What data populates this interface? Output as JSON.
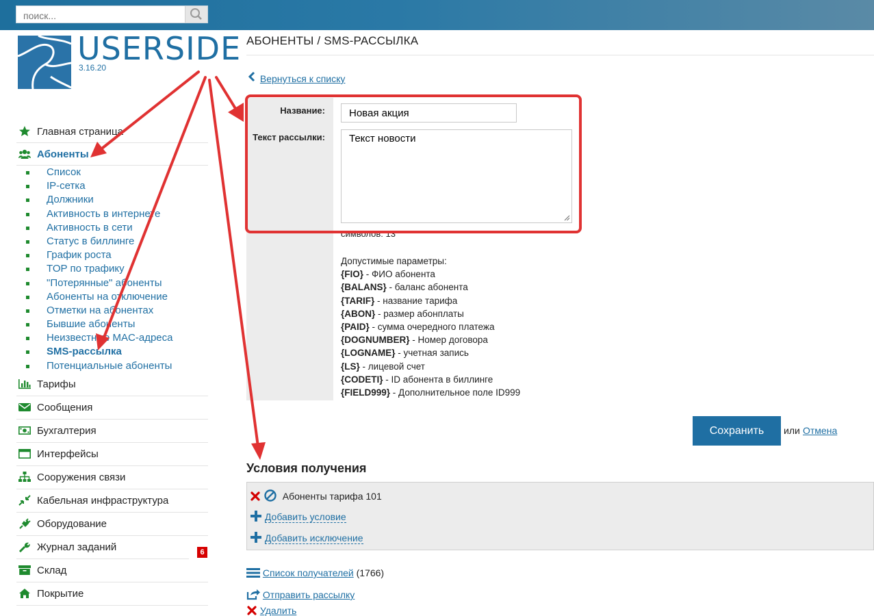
{
  "search": {
    "placeholder": "поиск..."
  },
  "logo": {
    "name": "USERSIDE",
    "version": "3.16.20"
  },
  "sidebar": {
    "items": [
      {
        "label": "Главная страница",
        "icon": "star-icon"
      },
      {
        "label": "Абоненты",
        "icon": "users-icon"
      },
      {
        "label": "Тарифы",
        "icon": "bar-chart-icon"
      },
      {
        "label": "Сообщения",
        "icon": "envelope-icon"
      },
      {
        "label": "Бухгалтерия",
        "icon": "money-icon"
      },
      {
        "label": "Интерфейсы",
        "icon": "window-icon"
      },
      {
        "label": "Сооружения связи",
        "icon": "sitemap-icon"
      },
      {
        "label": "Кабельная инфраструктура",
        "icon": "compress-icon"
      },
      {
        "label": "Оборудование",
        "icon": "plug-icon"
      },
      {
        "label": "Журнал заданий",
        "icon": "wrench-icon",
        "badge": "6"
      },
      {
        "label": "Склад",
        "icon": "archive-icon"
      },
      {
        "label": "Покрытие",
        "icon": "home-icon"
      }
    ],
    "subitems": [
      "Список",
      "IP-сетка",
      "Должники",
      "Активность в интернете",
      "Активность в сети",
      "Статус в биллинге",
      "График роста",
      "TOP по трафику",
      "\"Потерянные\" абоненты",
      "Абоненты на отключение",
      "Отметки на абонентах",
      "Бывшие абоненты",
      "Неизвестные MAC-адреса",
      "SMS-рассылка",
      "Потенциальные абоненты"
    ]
  },
  "page": {
    "title": "АБОНЕНТЫ / SMS-РАССЫЛКА",
    "back_link": "Вернуться к списку"
  },
  "form": {
    "name_label": "Название:",
    "name_value": "Новая акция",
    "text_label": "Текст рассылки:",
    "text_value": "Текст новости",
    "counter": "символов: 13",
    "params_title": "Допустимые параметры:",
    "params": [
      {
        "key": "{FIO}",
        "desc": " - ФИО абонента"
      },
      {
        "key": "{BALANS}",
        "desc": " - баланс абонента"
      },
      {
        "key": "{TARIF}",
        "desc": " - название тарифа"
      },
      {
        "key": "{ABON}",
        "desc": " - размер абонплаты"
      },
      {
        "key": "{PAID}",
        "desc": " - сумма очередного платежа"
      },
      {
        "key": "{DOGNUMBER}",
        "desc": " - Номер договора"
      },
      {
        "key": "{LOGNAME}",
        "desc": " - учетная запись"
      },
      {
        "key": "{LS}",
        "desc": " - лицевой счет"
      },
      {
        "key": "{CODETI}",
        "desc": " - ID абонента в биллинге"
      },
      {
        "key": "{FIELD999}",
        "desc": " - Дополнительное поле ID999"
      }
    ],
    "save_label": "Сохранить",
    "or_text": "или",
    "cancel_label": "Отмена"
  },
  "conditions": {
    "title": "Условия получения",
    "items": [
      "Абоненты тарифа 101"
    ],
    "add_condition": "Добавить условие",
    "add_exclusion": "Добавить исключение"
  },
  "actions": {
    "recipients": "Список получателей",
    "recipients_count": "(1766)",
    "send": "Отправить рассылку",
    "delete": "Удалить"
  },
  "colors": {
    "accent": "#1f6fa3",
    "annotation": "#e03232",
    "bullet": "#1e8a2e",
    "badge": "#d60000"
  }
}
